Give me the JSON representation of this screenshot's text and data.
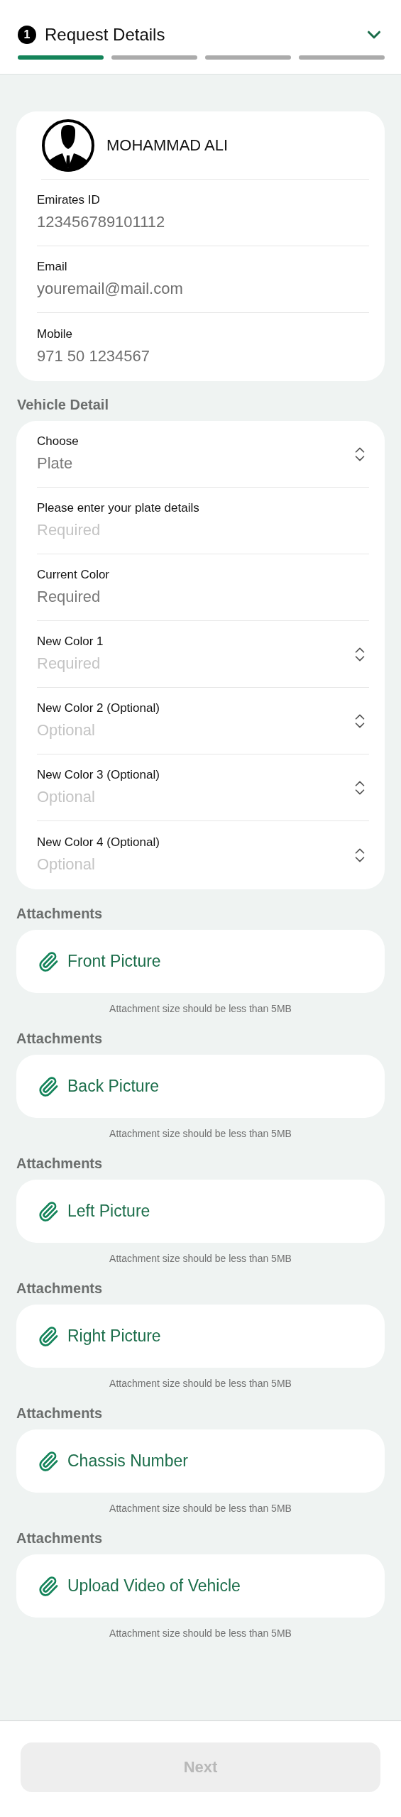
{
  "header": {
    "step_number": "1",
    "title": "Request Details",
    "steps": [
      {
        "selected": true
      },
      {
        "selected": false
      },
      {
        "selected": false
      },
      {
        "selected": false
      }
    ]
  },
  "profile": {
    "name": "MOHAMMAD ALI",
    "fields": [
      {
        "label": "Emirates ID",
        "value": "123456789101112"
      },
      {
        "label": "Email",
        "value": "youremail@mail.com"
      },
      {
        "label": "Mobile",
        "value": "971 50 1234567"
      }
    ]
  },
  "vehicle_detail": {
    "title": "Vehicle Detail",
    "fields": [
      {
        "kind": "select",
        "label": "Choose",
        "value": "Plate"
      },
      {
        "kind": "text",
        "label": "Please enter your plate details",
        "placeholder": "Required"
      },
      {
        "kind": "text",
        "label": "Current Color",
        "value": "Required"
      },
      {
        "kind": "select",
        "label": "New Color 1",
        "placeholder": "Required"
      },
      {
        "kind": "select",
        "label": "New Color 2 (Optional)",
        "placeholder": "Optional"
      },
      {
        "kind": "select",
        "label": "New Color 3 (Optional)",
        "placeholder": "Optional"
      },
      {
        "kind": "select",
        "label": "New Color 4 (Optional)",
        "placeholder": "Optional"
      }
    ]
  },
  "attachments": [
    {
      "title": "Attachments",
      "label": "Front Picture",
      "note": "Attachment size should be less than 5MB"
    },
    {
      "title": "Attachments",
      "label": "Back Picture",
      "note": "Attachment size should be less than 5MB"
    },
    {
      "title": "Attachments",
      "label": "Left Picture",
      "note": "Attachment size should be less than 5MB"
    },
    {
      "title": "Attachments",
      "label": "Right Picture",
      "note": "Attachment size should be less than 5MB"
    },
    {
      "title": "Attachments",
      "label": "Chassis Number",
      "note": "Attachment size should be less than 5MB"
    },
    {
      "title": "Attachments",
      "label": "Upload Video of Vehicle",
      "note": "Attachment size should be less than 5MB"
    }
  ],
  "footer": {
    "button": "Next",
    "disabled": true
  }
}
